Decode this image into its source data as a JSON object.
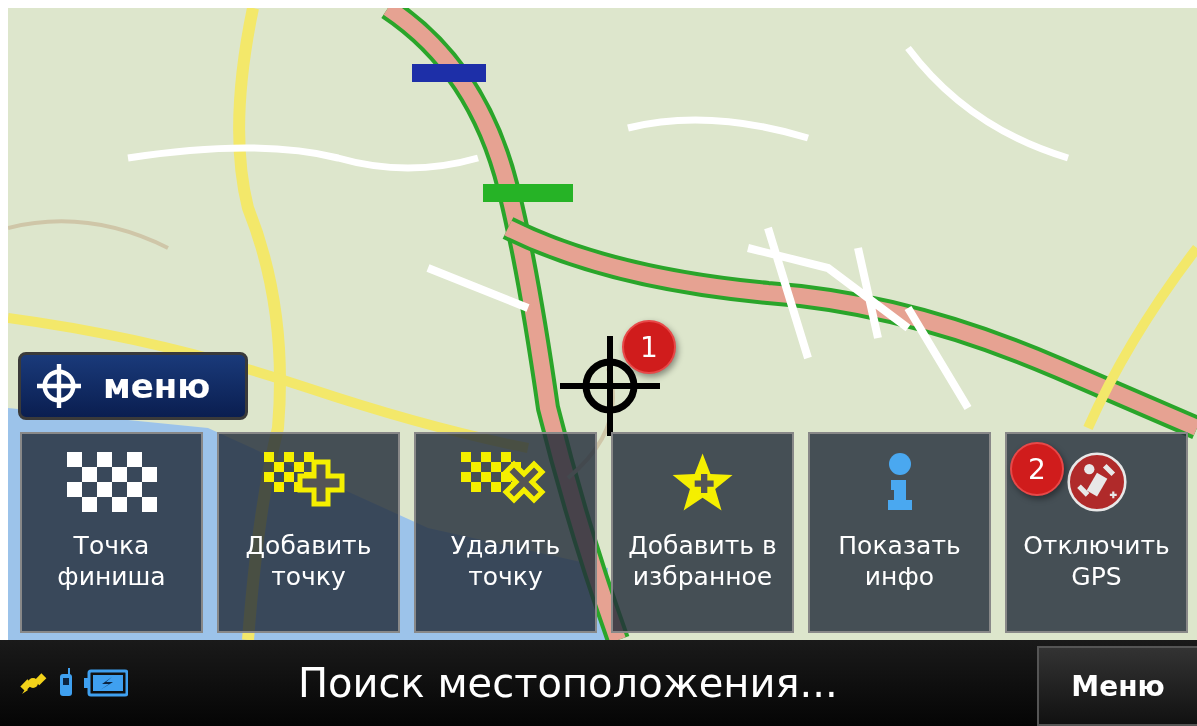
{
  "map_menu_button": {
    "label": "меню"
  },
  "markers": [
    {
      "label": "1"
    },
    {
      "label": "2"
    }
  ],
  "actions": [
    {
      "kind": "finish",
      "label": "Точка финиша"
    },
    {
      "kind": "add",
      "label": "Добавить точку"
    },
    {
      "kind": "remove",
      "label": "Удалить точку"
    },
    {
      "kind": "favorite",
      "label": "Добавить в избранное"
    },
    {
      "kind": "info",
      "label": "Показать инфо"
    },
    {
      "kind": "gps",
      "label": "Отключить GPS"
    }
  ],
  "status_bar": {
    "message": "Поиск местоположения...",
    "menu_button": "Меню"
  }
}
